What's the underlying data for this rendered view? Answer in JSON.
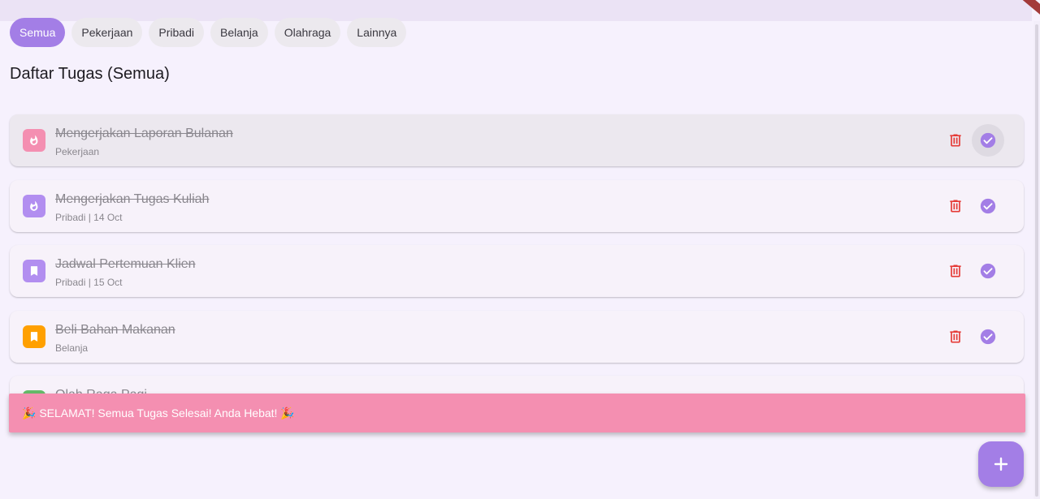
{
  "filters": [
    "Semua",
    "Pekerjaan",
    "Pribadi",
    "Belanja",
    "Olahraga",
    "Lainnya"
  ],
  "selected_filter": "Semua",
  "page_title": "Daftar Tugas (Semua)",
  "tasks": [
    {
      "title": "Mengerjakan Laporan Bulanan",
      "subtitle": "Pekerjaan",
      "icon": "flame-icon",
      "color": "#f48fb1",
      "done": true
    },
    {
      "title": "Mengerjakan Tugas Kuliah",
      "subtitle": "Pribadi  | 14 Oct",
      "icon": "flame-icon",
      "color": "#b28ef0",
      "done": true
    },
    {
      "title": "Jadwal Pertemuan Klien",
      "subtitle": "Pribadi  | 15 Oct",
      "icon": "bookmark-icon",
      "color": "#b28ef0",
      "done": true
    },
    {
      "title": "Beli Bahan Makanan",
      "subtitle": "Belanja",
      "icon": "bookmark-icon",
      "color": "#ffa000",
      "done": true
    },
    {
      "title": "Olah Raga Pagi",
      "subtitle": "",
      "icon": "bookmark-icon",
      "color": "#66bb6a",
      "done": true
    }
  ],
  "snackbar": {
    "message": "🎉 SELAMAT! Semua Tugas Selesai! Anda Hebat! 🎉"
  },
  "fab": {
    "icon": "plus-icon"
  },
  "colors": {
    "accent": "#a37ee6",
    "delete": "#e53935",
    "snackbar": "#f48fb1",
    "background": "#f6f1fd"
  }
}
